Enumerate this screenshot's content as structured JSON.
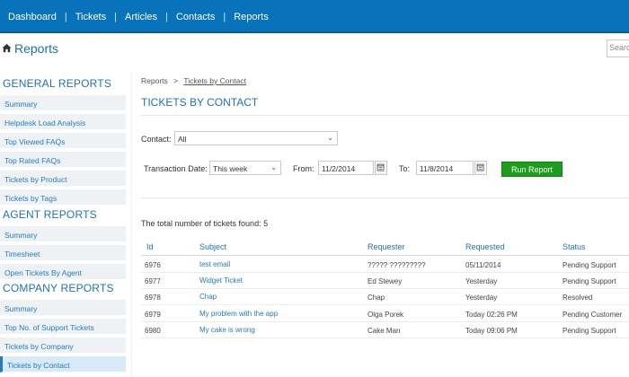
{
  "topnav": {
    "items": [
      "Dashboard",
      "Tickets",
      "Articles",
      "Contacts",
      "Reports"
    ],
    "separator": "|"
  },
  "header": {
    "title": "Reports",
    "search_placeholder": "Search"
  },
  "sidebar": {
    "general": {
      "heading": "GENERAL REPORTS",
      "items": [
        "Summary",
        "Helpdesk Load Analysis",
        "Top Viewed FAQs",
        "Top Rated FAQs",
        "Tickets by Product",
        "Tickets by Tags"
      ]
    },
    "agent": {
      "heading": "AGENT REPORTS",
      "items": [
        "Summary",
        "Timesheet",
        "Open Tickets By Agent"
      ]
    },
    "company": {
      "heading": "COMPANY REPORTS",
      "items": [
        "Summary",
        "Top No. of Support Tickets",
        "Tickets by Company",
        "Tickets by Contact"
      ]
    },
    "active_item": "Tickets by Contact"
  },
  "breadcrumb": {
    "root": "Reports",
    "separator": ">",
    "current": "Tickets by Contact"
  },
  "main": {
    "section_title": "TICKETS BY CONTACT",
    "contact_label": "Contact:",
    "contact_value": "All",
    "transaction_label": "Transaction Date:",
    "transaction_value": "This week",
    "from_label": "From:",
    "from_value": "11/2/2014",
    "to_label": "To:",
    "to_value": "11/8/2014",
    "run_button": "Run Report",
    "total_text": "The total number of tickets found: 5"
  },
  "table": {
    "columns": [
      "Id",
      "Subject",
      "Requester",
      "Requested",
      "Status"
    ],
    "rows": [
      {
        "id": "6976",
        "subject": "test email",
        "requester": "????? ?????????",
        "requested": "05/11/2014",
        "status": "Pending Support"
      },
      {
        "id": "6977",
        "subject": "Widget Ticket",
        "requester": "Ed Stewey",
        "requested": "Yesterday",
        "status": "Pending Support"
      },
      {
        "id": "6978",
        "subject": "Chap",
        "requester": "Chap",
        "requested": "Yesterday",
        "status": "Resolved"
      },
      {
        "id": "6979",
        "subject": "My problem with the app",
        "requester": "Olga Porek",
        "requested": "Today 02:26 PM",
        "status": "Pending Customer"
      },
      {
        "id": "6980",
        "subject": "My cake is wrong",
        "requester": "Cake Man",
        "requested": "Today 09:06 PM",
        "status": "Pending Support"
      }
    ]
  },
  "colors": {
    "topbar": "#0872ba",
    "link": "#2a7ab8",
    "heading": "#2371b6",
    "run_button": "#1e9c1e"
  },
  "icons": {
    "home": "home-icon",
    "chevron": "chevron-down-icon",
    "calendar": "calendar-icon"
  }
}
